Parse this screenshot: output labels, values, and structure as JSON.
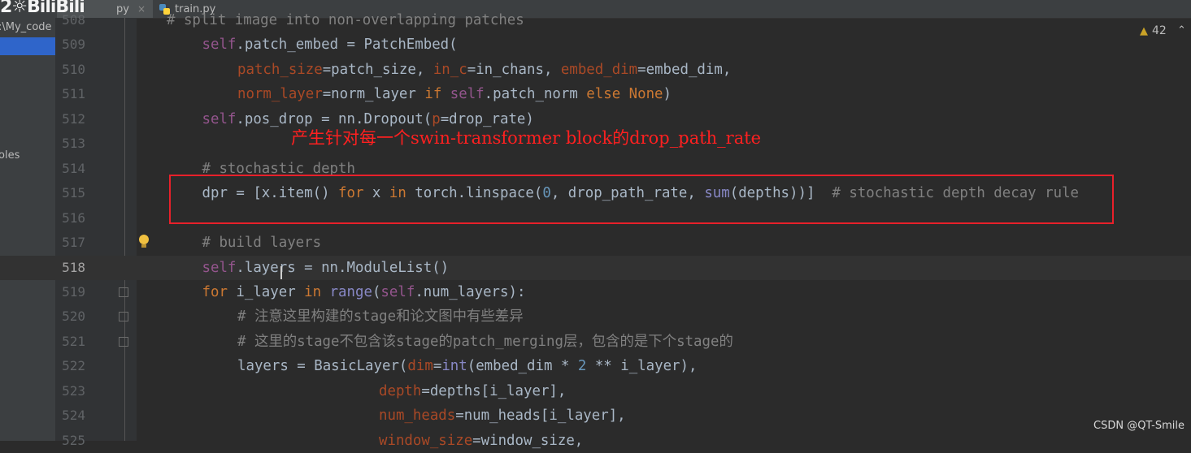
{
  "logo": "2☼BiliBili",
  "tabs": [
    {
      "label": "py",
      "close": "×"
    },
    {
      "label": "train.py"
    }
  ],
  "project_panel": {
    "path": ":\\My_code",
    "item": "oles"
  },
  "annotation": "产生针对每一个swin-transformer block的drop_path_rate",
  "inspection": {
    "count": "42",
    "warning_icon": "warning-triangle-icon",
    "up_arrow": "⌃"
  },
  "watermark": "CSDN @QT-Smile",
  "colors": {
    "keyword": "#cc7832",
    "self": "#94558d",
    "param": "#aa4926",
    "number": "#6897bb",
    "comment": "#808080",
    "highlight_box": "#e8202a",
    "annotation": "#ff2020"
  },
  "lines": [
    {
      "n": "508",
      "indent": 0,
      "tokens": [
        [
          "cm",
          "# split image into non-overlapping patches"
        ]
      ]
    },
    {
      "n": "509",
      "indent": 1,
      "tokens": [
        [
          "self",
          "self"
        ],
        [
          "",
          "."
        ],
        [
          "",
          "patch_embed = PatchEmbed("
        ]
      ]
    },
    {
      "n": "510",
      "indent": 2,
      "tokens": [
        [
          "param",
          "patch_size"
        ],
        [
          "",
          "=patch_size, "
        ],
        [
          "param",
          "in_c"
        ],
        [
          "",
          "=in_chans, "
        ],
        [
          "param",
          "embed_dim"
        ],
        [
          "",
          "=embed_dim,"
        ]
      ]
    },
    {
      "n": "511",
      "indent": 2,
      "tokens": [
        [
          "param",
          "norm_layer"
        ],
        [
          "",
          "=norm_layer "
        ],
        [
          "kw",
          "if "
        ],
        [
          "self",
          "self"
        ],
        [
          "",
          ".patch_norm "
        ],
        [
          "kw",
          "else None"
        ],
        [
          "",
          ")"
        ]
      ]
    },
    {
      "n": "512",
      "indent": 1,
      "tokens": [
        [
          "self",
          "self"
        ],
        [
          "",
          ".pos_drop = nn.Dropout("
        ],
        [
          "param",
          "p"
        ],
        [
          "",
          "=drop_rate)"
        ]
      ]
    },
    {
      "n": "513",
      "indent": 1,
      "tokens": []
    },
    {
      "n": "514",
      "indent": 1,
      "tokens": [
        [
          "cm",
          "# stochastic depth"
        ]
      ]
    },
    {
      "n": "515",
      "indent": 1,
      "tokens": [
        [
          "",
          "dpr = [x.item() "
        ],
        [
          "kw",
          "for "
        ],
        [
          "",
          "x "
        ],
        [
          "kw",
          "in "
        ],
        [
          "",
          "torch.linspace("
        ],
        [
          "num",
          "0"
        ],
        [
          "",
          ", drop_path_rate, "
        ],
        [
          "bi",
          "sum"
        ],
        [
          "",
          "(depths))]  "
        ],
        [
          "cm",
          "# stochastic depth decay rule"
        ]
      ]
    },
    {
      "n": "516",
      "indent": 1,
      "tokens": []
    },
    {
      "n": "517",
      "indent": 1,
      "tokens": [
        [
          "cm",
          "# build layers"
        ]
      ]
    },
    {
      "n": "518",
      "indent": 1,
      "current": true,
      "tokens": [
        [
          "self",
          "self"
        ],
        [
          "",
          ".layers = nn.ModuleList()"
        ]
      ]
    },
    {
      "n": "519",
      "indent": 1,
      "fold": true,
      "tokens": [
        [
          "kw",
          "for "
        ],
        [
          "",
          "i_layer "
        ],
        [
          "kw",
          "in "
        ],
        [
          "bi",
          "range"
        ],
        [
          "",
          "("
        ],
        [
          "self",
          "self"
        ],
        [
          "",
          ".num_layers):"
        ]
      ]
    },
    {
      "n": "520",
      "indent": 2,
      "fold": true,
      "tokens": [
        [
          "cm",
          "# "
        ],
        [
          "cmz",
          "注意这里构建的"
        ],
        [
          "cm",
          "stage"
        ],
        [
          "cmz",
          "和论文图中有些差异"
        ]
      ]
    },
    {
      "n": "521",
      "indent": 2,
      "fold": true,
      "tokens": [
        [
          "cm",
          "# "
        ],
        [
          "cmz",
          "这里的"
        ],
        [
          "cm",
          "stage"
        ],
        [
          "cmz",
          "不包含该"
        ],
        [
          "cm",
          "stage"
        ],
        [
          "cmz",
          "的"
        ],
        [
          "cm",
          "patch_merging"
        ],
        [
          "cmz",
          "层，包含的是下个"
        ],
        [
          "cm",
          "stage"
        ],
        [
          "cmz",
          "的"
        ]
      ]
    },
    {
      "n": "522",
      "indent": 2,
      "tokens": [
        [
          "",
          "layers = BasicLayer("
        ],
        [
          "param",
          "dim"
        ],
        [
          "",
          "="
        ],
        [
          "bi",
          "int"
        ],
        [
          "",
          "(embed_dim * "
        ],
        [
          "num",
          "2"
        ],
        [
          "",
          " ** i_layer),"
        ]
      ]
    },
    {
      "n": "523",
      "indent": 6,
      "tokens": [
        [
          "param",
          "depth"
        ],
        [
          "",
          "=depths[i_layer],"
        ]
      ]
    },
    {
      "n": "524",
      "indent": 6,
      "tokens": [
        [
          "param",
          "num_heads"
        ],
        [
          "",
          "=num_heads[i_layer],"
        ]
      ]
    },
    {
      "n": "525",
      "indent": 6,
      "tokens": [
        [
          "param",
          "window_size"
        ],
        [
          "",
          "=window_size,"
        ]
      ]
    }
  ]
}
